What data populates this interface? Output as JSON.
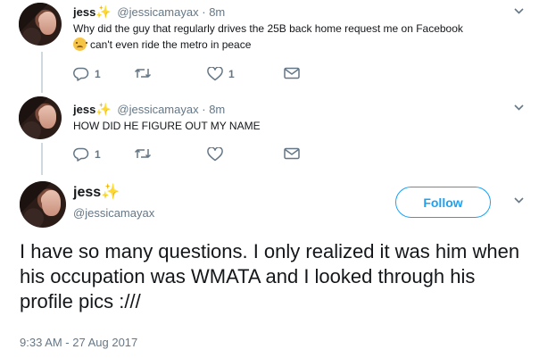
{
  "tweets": [
    {
      "name": "jess",
      "handle": "@jessicamayax",
      "separator": "·",
      "age": "8m",
      "text_line1": "Why did the guy that regularly drives the 25B back home request me on Facebook",
      "text_line2": "can't even ride the metro in peace",
      "emoji": "disappointed-relieved-face",
      "reply_count": "1",
      "like_count": "1"
    },
    {
      "name": "jess",
      "handle": "@jessicamayax",
      "separator": "·",
      "age": "8m",
      "text": "HOW DID HE FIGURE OUT MY NAME",
      "reply_count": "1",
      "like_count": ""
    }
  ],
  "main_tweet": {
    "name": "jess",
    "handle": "@jessicamayax",
    "follow_label": "Follow",
    "text": "I have so many questions. I only realized it was him when his occupation was WMATA and I looked through his profile pics :///",
    "timestamp": "9:33 AM - 27 Aug 2017"
  },
  "icons": {
    "name_badge": "sparkles-icon",
    "reply": "reply-icon",
    "retweet": "retweet-icon",
    "like": "heart-icon",
    "message": "direct-message-icon",
    "menu": "chevron-down-icon"
  },
  "colors": {
    "accent": "#1da1f2",
    "secondary_text": "#657786",
    "thread_line": "#cfd9de",
    "sparkle": "#ad7fd8"
  }
}
